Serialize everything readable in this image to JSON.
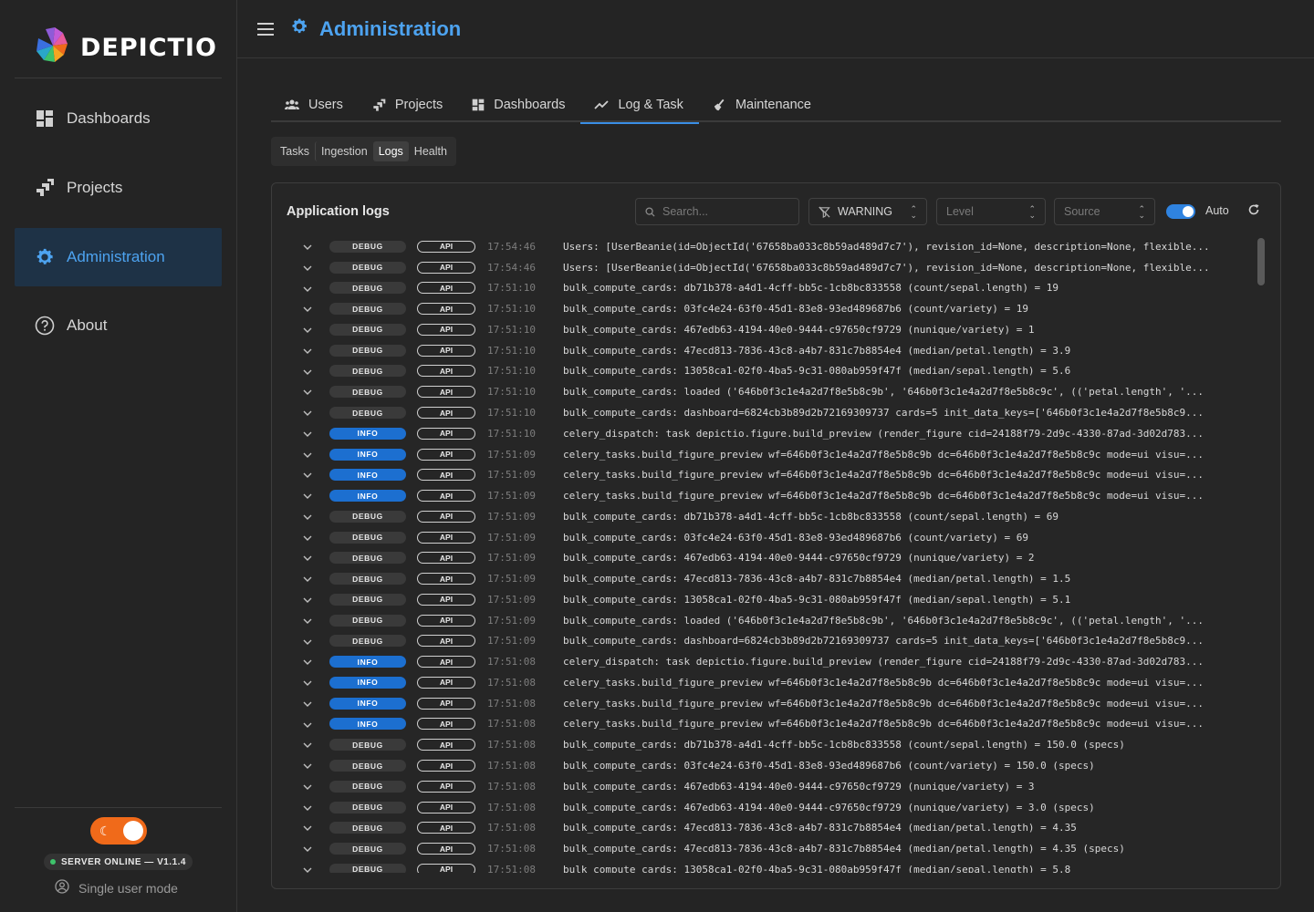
{
  "sidebar": {
    "brand": "DEPICTIO",
    "nav": [
      {
        "label": "Dashboards",
        "icon": "dashboard-grid-icon",
        "active": false
      },
      {
        "label": "Projects",
        "icon": "projects-icon",
        "active": false
      },
      {
        "label": "Administration",
        "icon": "gear-icon",
        "active": true
      },
      {
        "label": "About",
        "icon": "help-circle-icon",
        "active": false
      }
    ],
    "server_status": "SERVER ONLINE — V1.1.4",
    "user_mode": "Single user mode"
  },
  "header": {
    "title": "Administration"
  },
  "tabs": [
    {
      "label": "Users",
      "active": false
    },
    {
      "label": "Projects",
      "active": false
    },
    {
      "label": "Dashboards",
      "active": false
    },
    {
      "label": "Log & Task",
      "active": true
    },
    {
      "label": "Maintenance",
      "active": false
    }
  ],
  "subtabs": [
    {
      "label": "Tasks",
      "active": false
    },
    {
      "label": "Ingestion",
      "active": false
    },
    {
      "label": "Logs",
      "active": true
    },
    {
      "label": "Health",
      "active": false
    }
  ],
  "logs": {
    "title": "Application logs",
    "search_placeholder": "Search...",
    "level_filter_value": "WARNING",
    "level_placeholder": "Level",
    "source_placeholder": "Source",
    "auto_label": "Auto",
    "colors": {
      "info": "#1c6fd0",
      "accent": "#4da3f0",
      "toggle": "#2f83e0"
    },
    "rows": [
      {
        "level": "DEBUG",
        "source": "API",
        "time": "17:54:46",
        "message": "Users: [UserBeanie(id=ObjectId('67658ba033c8b59ad489d7c7'), revision_id=None, description=None, flexible..."
      },
      {
        "level": "DEBUG",
        "source": "API",
        "time": "17:54:46",
        "message": "Users: [UserBeanie(id=ObjectId('67658ba033c8b59ad489d7c7'), revision_id=None, description=None, flexible..."
      },
      {
        "level": "DEBUG",
        "source": "API",
        "time": "17:51:10",
        "message": "bulk_compute_cards: db71b378-a4d1-4cff-bb5c-1cb8bc833558 (count/sepal.length) = 19"
      },
      {
        "level": "DEBUG",
        "source": "API",
        "time": "17:51:10",
        "message": "bulk_compute_cards: 03fc4e24-63f0-45d1-83e8-93ed489687b6 (count/variety) = 19"
      },
      {
        "level": "DEBUG",
        "source": "API",
        "time": "17:51:10",
        "message": "bulk_compute_cards: 467edb63-4194-40e0-9444-c97650cf9729 (nunique/variety) = 1"
      },
      {
        "level": "DEBUG",
        "source": "API",
        "time": "17:51:10",
        "message": "bulk_compute_cards: 47ecd813-7836-43c8-a4b7-831c7b8854e4 (median/petal.length) = 3.9"
      },
      {
        "level": "DEBUG",
        "source": "API",
        "time": "17:51:10",
        "message": "bulk_compute_cards: 13058ca1-02f0-4ba5-9c31-080ab959f47f (median/sepal.length) = 5.6"
      },
      {
        "level": "DEBUG",
        "source": "API",
        "time": "17:51:10",
        "message": "bulk_compute_cards: loaded ('646b0f3c1e4a2d7f8e5b8c9b', '646b0f3c1e4a2d7f8e5b8c9c', (('petal.length', '..."
      },
      {
        "level": "DEBUG",
        "source": "API",
        "time": "17:51:10",
        "message": "bulk_compute_cards: dashboard=6824cb3b89d2b72169309737 cards=5 init_data_keys=['646b0f3c1e4a2d7f8e5b8c9..."
      },
      {
        "level": "INFO",
        "source": "API",
        "time": "17:51:10",
        "message": "celery_dispatch: task depictio.figure.build_preview (render_figure cid=24188f79-2d9c-4330-87ad-3d02d783..."
      },
      {
        "level": "INFO",
        "source": "API",
        "time": "17:51:09",
        "message": "celery_tasks.build_figure_preview wf=646b0f3c1e4a2d7f8e5b8c9b dc=646b0f3c1e4a2d7f8e5b8c9c mode=ui visu=..."
      },
      {
        "level": "INFO",
        "source": "API",
        "time": "17:51:09",
        "message": "celery_tasks.build_figure_preview wf=646b0f3c1e4a2d7f8e5b8c9b dc=646b0f3c1e4a2d7f8e5b8c9c mode=ui visu=..."
      },
      {
        "level": "INFO",
        "source": "API",
        "time": "17:51:09",
        "message": "celery_tasks.build_figure_preview wf=646b0f3c1e4a2d7f8e5b8c9b dc=646b0f3c1e4a2d7f8e5b8c9c mode=ui visu=..."
      },
      {
        "level": "DEBUG",
        "source": "API",
        "time": "17:51:09",
        "message": "bulk_compute_cards: db71b378-a4d1-4cff-bb5c-1cb8bc833558 (count/sepal.length) = 69"
      },
      {
        "level": "DEBUG",
        "source": "API",
        "time": "17:51:09",
        "message": "bulk_compute_cards: 03fc4e24-63f0-45d1-83e8-93ed489687b6 (count/variety) = 69"
      },
      {
        "level": "DEBUG",
        "source": "API",
        "time": "17:51:09",
        "message": "bulk_compute_cards: 467edb63-4194-40e0-9444-c97650cf9729 (nunique/variety) = 2"
      },
      {
        "level": "DEBUG",
        "source": "API",
        "time": "17:51:09",
        "message": "bulk_compute_cards: 47ecd813-7836-43c8-a4b7-831c7b8854e4 (median/petal.length) = 1.5"
      },
      {
        "level": "DEBUG",
        "source": "API",
        "time": "17:51:09",
        "message": "bulk_compute_cards: 13058ca1-02f0-4ba5-9c31-080ab959f47f (median/sepal.length) = 5.1"
      },
      {
        "level": "DEBUG",
        "source": "API",
        "time": "17:51:09",
        "message": "bulk_compute_cards: loaded ('646b0f3c1e4a2d7f8e5b8c9b', '646b0f3c1e4a2d7f8e5b8c9c', (('petal.length', '..."
      },
      {
        "level": "DEBUG",
        "source": "API",
        "time": "17:51:09",
        "message": "bulk_compute_cards: dashboard=6824cb3b89d2b72169309737 cards=5 init_data_keys=['646b0f3c1e4a2d7f8e5b8c9..."
      },
      {
        "level": "INFO",
        "source": "API",
        "time": "17:51:08",
        "message": "celery_dispatch: task depictio.figure.build_preview (render_figure cid=24188f79-2d9c-4330-87ad-3d02d783..."
      },
      {
        "level": "INFO",
        "source": "API",
        "time": "17:51:08",
        "message": "celery_tasks.build_figure_preview wf=646b0f3c1e4a2d7f8e5b8c9b dc=646b0f3c1e4a2d7f8e5b8c9c mode=ui visu=..."
      },
      {
        "level": "INFO",
        "source": "API",
        "time": "17:51:08",
        "message": "celery_tasks.build_figure_preview wf=646b0f3c1e4a2d7f8e5b8c9b dc=646b0f3c1e4a2d7f8e5b8c9c mode=ui visu=..."
      },
      {
        "level": "INFO",
        "source": "API",
        "time": "17:51:08",
        "message": "celery_tasks.build_figure_preview wf=646b0f3c1e4a2d7f8e5b8c9b dc=646b0f3c1e4a2d7f8e5b8c9c mode=ui visu=..."
      },
      {
        "level": "DEBUG",
        "source": "API",
        "time": "17:51:08",
        "message": "bulk_compute_cards: db71b378-a4d1-4cff-bb5c-1cb8bc833558 (count/sepal.length) = 150.0 (specs)"
      },
      {
        "level": "DEBUG",
        "source": "API",
        "time": "17:51:08",
        "message": "bulk_compute_cards: 03fc4e24-63f0-45d1-83e8-93ed489687b6 (count/variety) = 150.0 (specs)"
      },
      {
        "level": "DEBUG",
        "source": "API",
        "time": "17:51:08",
        "message": "bulk_compute_cards: 467edb63-4194-40e0-9444-c97650cf9729 (nunique/variety) = 3"
      },
      {
        "level": "DEBUG",
        "source": "API",
        "time": "17:51:08",
        "message": "bulk_compute_cards: 467edb63-4194-40e0-9444-c97650cf9729 (nunique/variety) = 3.0 (specs)"
      },
      {
        "level": "DEBUG",
        "source": "API",
        "time": "17:51:08",
        "message": "bulk_compute_cards: 47ecd813-7836-43c8-a4b7-831c7b8854e4 (median/petal.length) = 4.35"
      },
      {
        "level": "DEBUG",
        "source": "API",
        "time": "17:51:08",
        "message": "bulk_compute_cards: 47ecd813-7836-43c8-a4b7-831c7b8854e4 (median/petal.length) = 4.35 (specs)"
      },
      {
        "level": "DEBUG",
        "source": "API",
        "time": "17:51:08",
        "message": "bulk_compute_cards: 13058ca1-02f0-4ba5-9c31-080ab959f47f (median/sepal.length) = 5.8"
      }
    ]
  }
}
